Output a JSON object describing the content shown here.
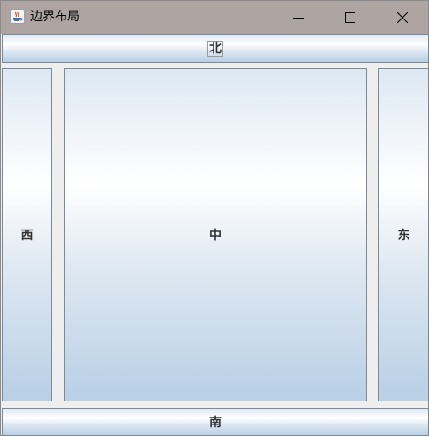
{
  "window": {
    "title": "边界布局",
    "icon": "java-coffee-cup-icon"
  },
  "controls": {
    "minimize": "minimize-icon",
    "maximize": "maximize-icon",
    "close": "close-icon"
  },
  "buttons": {
    "north": "北",
    "west": "西",
    "center": "中",
    "east": "东",
    "south": "南"
  },
  "colors": {
    "titlebar": "#aea4a2",
    "button_gradient_top": "#ffffff",
    "button_gradient_bottom": "#b8cfe5",
    "button_border": "#7a8a99",
    "background": "#eeeeee"
  }
}
